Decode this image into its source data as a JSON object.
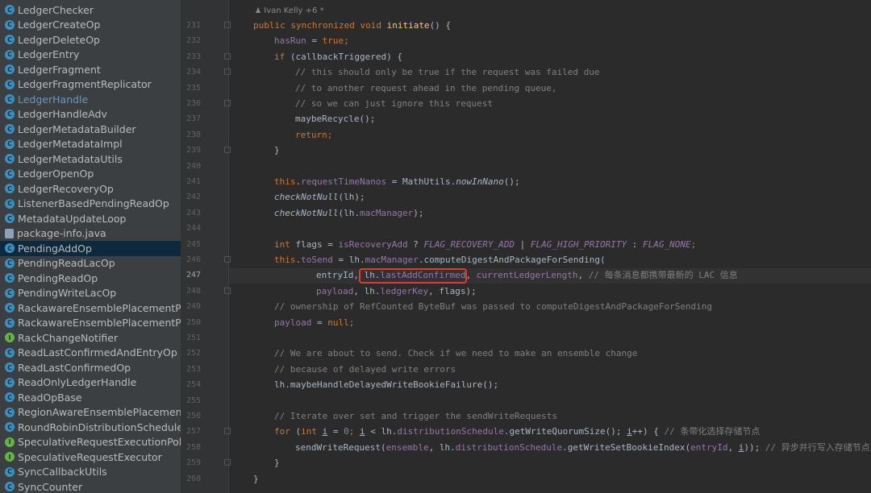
{
  "sidebar": {
    "items": [
      {
        "label": "LedgerChecker",
        "icon": "class-icon"
      },
      {
        "label": "LedgerCreateOp",
        "icon": "class-icon"
      },
      {
        "label": "LedgerDeleteOp",
        "icon": "class-icon"
      },
      {
        "label": "LedgerEntry",
        "icon": "class-icon"
      },
      {
        "label": "LedgerFragment",
        "icon": "class-icon"
      },
      {
        "label": "LedgerFragmentReplicator",
        "icon": "class-icon"
      },
      {
        "label": "LedgerHandle",
        "icon": "class-icon"
      },
      {
        "label": "LedgerHandleAdv",
        "icon": "class-icon"
      },
      {
        "label": "LedgerMetadataBuilder",
        "icon": "class-icon"
      },
      {
        "label": "LedgerMetadataImpl",
        "icon": "class-icon"
      },
      {
        "label": "LedgerMetadataUtils",
        "icon": "class-icon"
      },
      {
        "label": "LedgerOpenOp",
        "icon": "class-icon"
      },
      {
        "label": "LedgerRecoveryOp",
        "icon": "class-icon"
      },
      {
        "label": "ListenerBasedPendingReadOp",
        "icon": "class-icon"
      },
      {
        "label": "MetadataUpdateLoop",
        "icon": "class-icon"
      },
      {
        "label": "package-info.java",
        "icon": "file-icon"
      },
      {
        "label": "PendingAddOp",
        "icon": "class-icon"
      },
      {
        "label": "PendingReadLacOp",
        "icon": "class-icon"
      },
      {
        "label": "PendingReadOp",
        "icon": "class-icon"
      },
      {
        "label": "PendingWriteLacOp",
        "icon": "class-icon"
      },
      {
        "label": "RackawareEnsemblePlacementPolicy",
        "icon": "class-icon"
      },
      {
        "label": "RackawareEnsemblePlacementPolicyImpl",
        "icon": "class-icon"
      },
      {
        "label": "RackChangeNotifier",
        "icon": "interface-icon"
      },
      {
        "label": "ReadLastConfirmedAndEntryOp",
        "icon": "class-icon"
      },
      {
        "label": "ReadLastConfirmedOp",
        "icon": "class-icon"
      },
      {
        "label": "ReadOnlyLedgerHandle",
        "icon": "class-icon"
      },
      {
        "label": "ReadOpBase",
        "icon": "class-icon"
      },
      {
        "label": "RegionAwareEnsemblePlacementPolicy",
        "icon": "class-icon"
      },
      {
        "label": "RoundRobinDistributionSchedule",
        "icon": "class-icon"
      },
      {
        "label": "SpeculativeRequestExecutionPolicy",
        "icon": "interface-icon"
      },
      {
        "label": "SpeculativeRequestExecutor",
        "icon": "interface-icon"
      },
      {
        "label": "SyncCallbackUtils",
        "icon": "class-icon"
      },
      {
        "label": "SyncCounter",
        "icon": "class-icon"
      }
    ],
    "selected_index": 16,
    "linked_index": 6
  },
  "editor": {
    "author_annotation": "Ivan Kelly +6 *",
    "current_line": "247",
    "line_numbers": [
      "231",
      "232",
      "233",
      "234",
      "235",
      "236",
      "237",
      "238",
      "239",
      "240",
      "241",
      "242",
      "243",
      "244",
      "245",
      "246",
      "247",
      "248",
      "249",
      "250",
      "251",
      "252",
      "253",
      "254",
      "255",
      "256",
      "257",
      "258",
      "259",
      "260"
    ],
    "code": {
      "l231": {
        "a": "public synchronized void ",
        "b": "initiate",
        "c": "() {"
      },
      "l232": {
        "a": "hasRun",
        "b": " = ",
        "c": "true",
        "d": ";"
      },
      "l233": {
        "a": "if ",
        "b": "(callbackTriggered) {"
      },
      "l234": "// this should only be true if the request was failed due",
      "l235": "// to another request ahead in the pending queue,",
      "l236": "// so we can just ignore this request",
      "l237": "maybeRecycle();",
      "l238": {
        "a": "return",
        "b": ";"
      },
      "l239": "}",
      "l241": {
        "a": "this",
        "b": ".",
        "c": "requestTimeNanos",
        "d": " = MathUtils.",
        "e": "nowInNano",
        "f": "();"
      },
      "l242": {
        "a": "checkNotNull",
        "b": "(lh);"
      },
      "l243": {
        "a": "checkNotNull",
        "b": "(lh.",
        "c": "macManager",
        "d": ");"
      },
      "l245": {
        "a": "int ",
        "b": "flags = ",
        "c": "isRecoveryAdd",
        "d": " ? ",
        "e": "FLAG_RECOVERY_ADD",
        "f": " | ",
        "g": "FLAG_HIGH_PRIORITY",
        "h": " : ",
        "i": "FLAG_NONE",
        "j": ";"
      },
      "l246": {
        "a": "this",
        "b": ".",
        "c": "toSend",
        "d": " = lh.",
        "e": "macManager",
        "f": ".computeDigestAndPackageForSending("
      },
      "l247": {
        "a": "entryId, ",
        "b": "lh.",
        "c": "lastAddConfirmed",
        "d": ", ",
        "e": "currentLedgerLength",
        "f": ", ",
        "g": "// 每条消息都携带最新的 LAC 信息"
      },
      "l248": {
        "a": "payload",
        "b": ", lh.",
        "c": "ledgerKey",
        "d": ", flags);"
      },
      "l249": "// ownership of RefCounted ByteBuf was passed to computeDigestAndPackageForSending",
      "l250": {
        "a": "payload",
        "b": " = ",
        "c": "null",
        "d": ";"
      },
      "l252": "// We are about to send. Check if we need to make an ensemble change",
      "l253": "// because of delayed write errors",
      "l254": "lh.maybeHandleDelayedWriteBookieFailure();",
      "l256": "// Iterate over set and trigger the sendWriteRequests",
      "l257": {
        "a": "for ",
        "b": "(",
        "c": "int ",
        "d": "i",
        "e": " = ",
        "f": "0",
        "g": "; ",
        "h": "i",
        "i": " < lh.",
        "j": "distributionSchedule",
        "k": ".getWriteQuorumSize(); ",
        "l": "i",
        "m": "++) { ",
        "n": "// 条带化选择存储节点"
      },
      "l258": {
        "a": "sendWriteRequest(",
        "b": "ensemble",
        "c": ", lh.",
        "d": "distributionSchedule",
        "e": ".getWriteSetBookieIndex(",
        "f": "entryId",
        "g": ", ",
        "h": "i",
        "i": ")); ",
        "j": "// 异步并行写入存储节点"
      },
      "l259": "}",
      "l260": "}"
    }
  }
}
